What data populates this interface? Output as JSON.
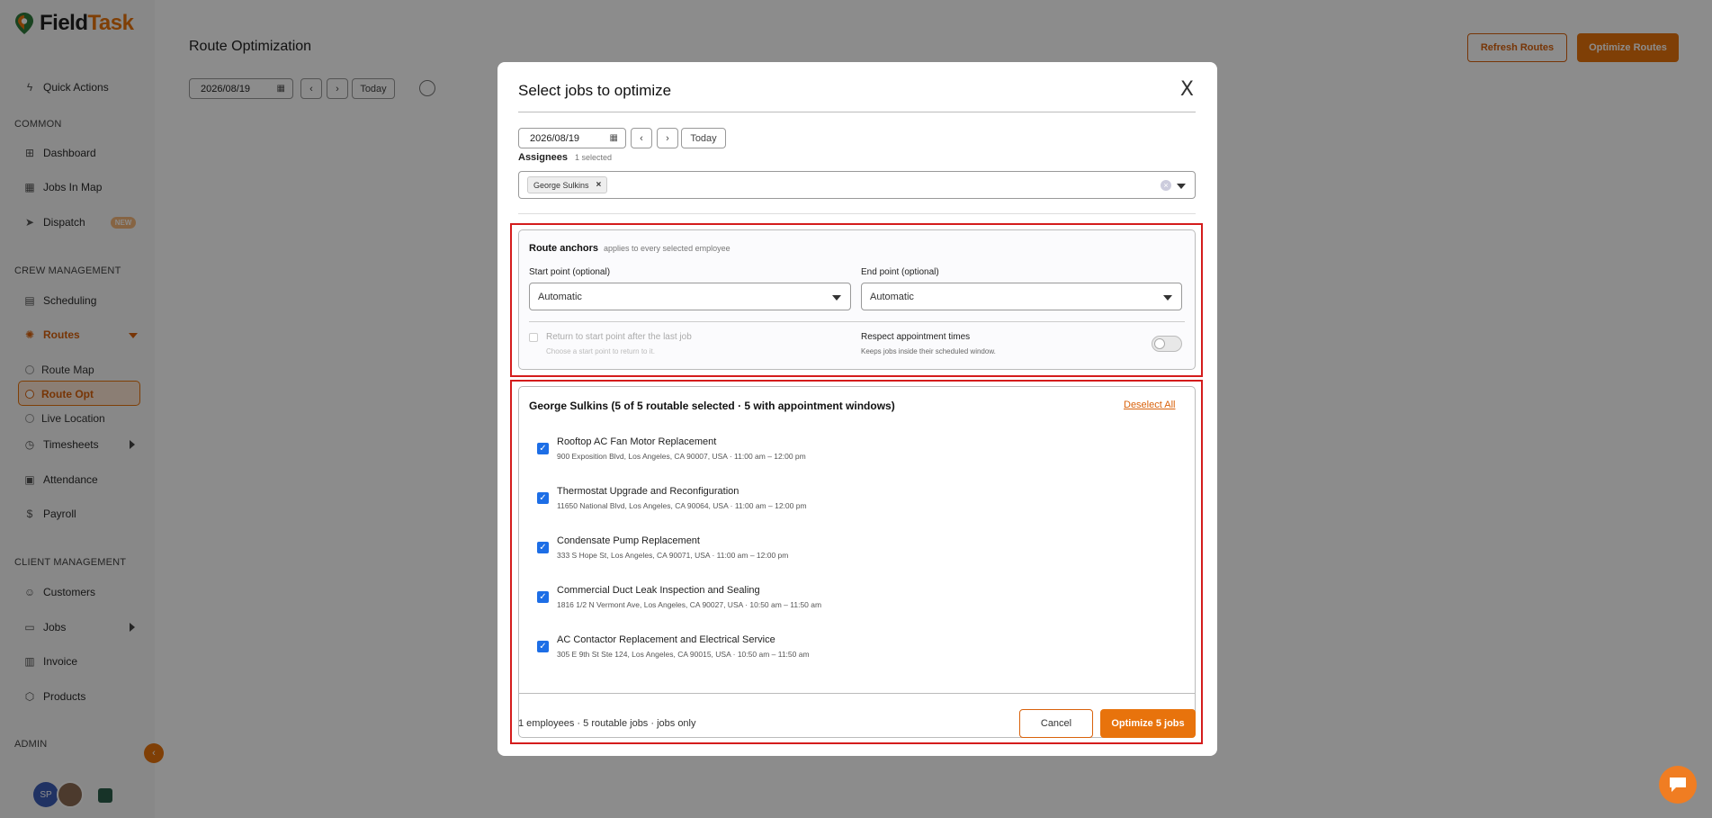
{
  "app": {
    "logo_prefix": "Field",
    "logo_suffix": "Task"
  },
  "sidebar": {
    "quick_actions": "Quick Actions",
    "sections": {
      "common": "COMMON",
      "crew": "CREW MANAGEMENT",
      "client": "CLIENT MANAGEMENT",
      "admin": "ADMIN"
    },
    "items": {
      "dashboard": "Dashboard",
      "jobs_in_map": "Jobs In Map",
      "dispatch": "Dispatch",
      "dispatch_badge": "NEW",
      "scheduling": "Scheduling",
      "routes": "Routes",
      "route_map": "Route Map",
      "route_opt": "Route Opt",
      "live_location": "Live Location",
      "timesheets": "Timesheets",
      "attendance": "Attendance",
      "payroll": "Payroll",
      "customers": "Customers",
      "jobs": "Jobs",
      "invoice": "Invoice",
      "products": "Products"
    },
    "avatar_initials": "SP"
  },
  "main": {
    "title": "Route Optimization",
    "date": "2026/08/19",
    "today": "Today",
    "refresh_routes": "Refresh Routes",
    "optimize_routes": "Optimize Routes"
  },
  "modal": {
    "title": "Select jobs to optimize",
    "close": "X",
    "date": "2026/08/19",
    "today": "Today",
    "assignees_label": "Assignees",
    "assignees_count": "1 selected",
    "assignee_chip": "George Sulkins",
    "anchors": {
      "title": "Route anchors",
      "subtitle": "applies to every selected employee",
      "start_label": "Start point (optional)",
      "start_value": "Automatic",
      "end_label": "End point (optional)",
      "end_value": "Automatic",
      "return_label": "Return to start point after the last job",
      "return_hint": "Choose a start point to return to it.",
      "respect_label": "Respect appointment times",
      "respect_hint": "Keeps jobs inside their scheduled window."
    },
    "jobs_header": "George Sulkins (5 of 5 routable selected · 5 with appointment windows)",
    "deselect_all": "Deselect All",
    "jobs": [
      {
        "title": "Rooftop AC Fan Motor Replacement",
        "detail": "900 Exposition Blvd, Los Angeles, CA 90007, USA · 11:00 am – 12:00 pm"
      },
      {
        "title": "Thermostat Upgrade and Reconfiguration",
        "detail": "11650 National Blvd, Los Angeles, CA 90064, USA · 11:00 am – 12:00 pm"
      },
      {
        "title": "Condensate Pump Replacement",
        "detail": "333 S Hope St, Los Angeles, CA 90071, USA · 11:00 am – 12:00 pm"
      },
      {
        "title": "Commercial Duct Leak Inspection and Sealing",
        "detail": "1816 1/2 N Vermont Ave, Los Angeles, CA 90027, USA · 10:50 am – 11:50 am"
      },
      {
        "title": "AC Contactor Replacement and Electrical Service",
        "detail": "305 E 9th St Ste 124, Los Angeles, CA 90015, USA · 10:50 am – 11:50 am"
      }
    ],
    "footer_summary": "1 employees · 5 routable jobs · jobs only",
    "cancel": "Cancel",
    "optimize": "Optimize 5 jobs"
  },
  "colors": {
    "accent": "#e8730c",
    "highlight_frame": "#d41c1c",
    "checkbox": "#1d6ee6"
  }
}
